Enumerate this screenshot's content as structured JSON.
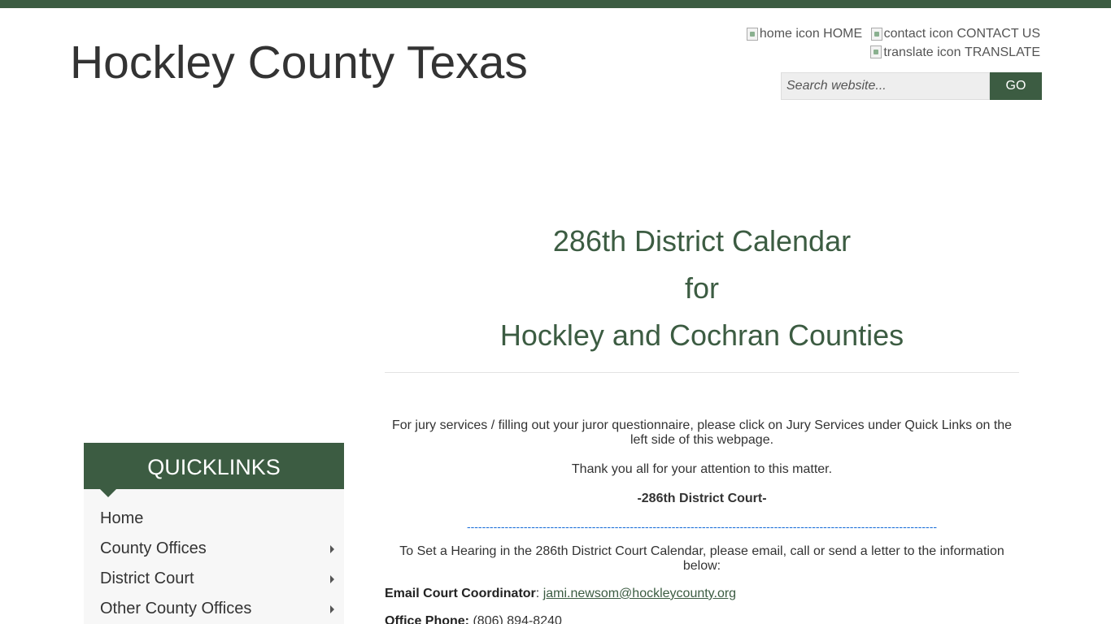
{
  "site": {
    "title": "Hockley County Texas"
  },
  "header": {
    "links": [
      {
        "alt": "home icon",
        "label": "HOME"
      },
      {
        "alt": "contact icon",
        "label": "CONTACT US"
      },
      {
        "alt": "translate icon",
        "label": "TRANSLATE"
      }
    ],
    "search": {
      "placeholder": "Search website...",
      "button": "GO"
    }
  },
  "colors": {
    "brand_green": "#3c5c42",
    "link_blue": "#1a6fd8"
  },
  "main": {
    "heading_lines": [
      "286th District Calendar",
      "for",
      "Hockley and Cochran Counties"
    ],
    "p1": "For jury services / filling out your juror questionnaire, please click on Jury Services under Quick Links on the left side of this webpage.",
    "p2": "Thank you all for your attention to this matter.",
    "p3": "-286th District Court-",
    "dashes": "----------------------------------------------------------------------------------------------------------------------------",
    "p4": "To Set a Hearing in the 286th District Court Calendar, please email, call or send a letter to the information below:",
    "email": {
      "label": "Email Court Coordinator",
      "sep": ":",
      "value": "jami.newsom@hockleycounty.org"
    },
    "phone": {
      "label": "Office Phone:",
      "value": "(806) 894-8240"
    }
  },
  "quicklinks": {
    "title": "QUICKLINKS",
    "items": [
      {
        "label": "Home",
        "has_submenu": false
      },
      {
        "label": "County Offices",
        "has_submenu": true
      },
      {
        "label": "District Court",
        "has_submenu": true
      },
      {
        "label": "Other County Offices",
        "has_submenu": true
      }
    ]
  }
}
